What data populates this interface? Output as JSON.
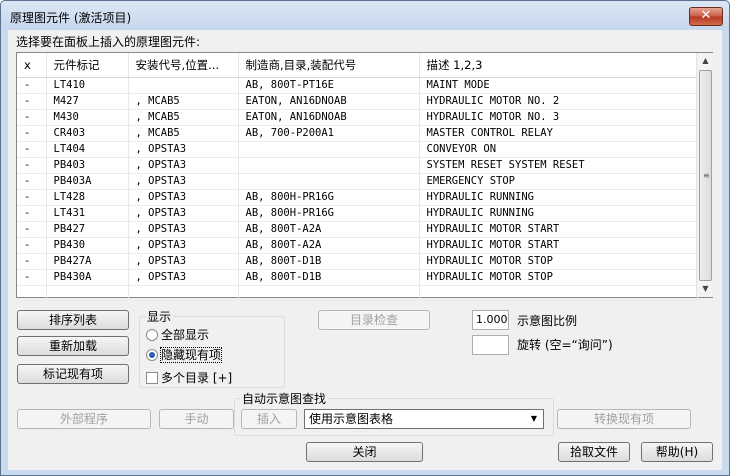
{
  "window": {
    "title": "原理图元件 (激活项目)",
    "close_glyph": "✕"
  },
  "instruction": "选择要在面板上插入的原理图元件:",
  "table": {
    "columns": [
      "x",
      "元件标记",
      "安装代号,位置...",
      "制造商,目录,装配代号",
      "描述 1,2,3"
    ],
    "rows": [
      [
        "-",
        "LT410",
        "",
        "AB, 800T-PT16E",
        "MAINT MODE"
      ],
      [
        "-",
        "M427",
        ", MCAB5",
        "EATON, AN16DNOAB",
        "HYDRAULIC MOTOR NO. 2"
      ],
      [
        "-",
        "M430",
        ", MCAB5",
        "EATON, AN16DNOAB",
        "HYDRAULIC MOTOR NO. 3"
      ],
      [
        "-",
        "CR403",
        ", MCAB5",
        "AB, 700-P200A1",
        "MASTER CONTROL RELAY"
      ],
      [
        "-",
        "LT404",
        ", OPSTA3",
        "",
        "CONVEYOR ON"
      ],
      [
        "-",
        "PB403",
        ", OPSTA3",
        "",
        "SYSTEM RESET SYSTEM RESET"
      ],
      [
        "-",
        "PB403A",
        ", OPSTA3",
        "",
        "EMERGENCY STOP"
      ],
      [
        "-",
        "LT428",
        ", OPSTA3",
        "AB, 800H-PR16G",
        "HYDRAULIC RUNNING"
      ],
      [
        "-",
        "LT431",
        ", OPSTA3",
        "AB, 800H-PR16G",
        "HYDRAULIC RUNNING"
      ],
      [
        "-",
        "PB427",
        ", OPSTA3",
        "AB, 800T-A2A",
        "HYDRAULIC MOTOR START"
      ],
      [
        "-",
        "PB430",
        ", OPSTA3",
        "AB, 800T-A2A",
        "HYDRAULIC MOTOR START"
      ],
      [
        "-",
        "PB427A",
        ", OPSTA3",
        "AB, 800T-D1B",
        "HYDRAULIC MOTOR STOP"
      ],
      [
        "-",
        "PB430A",
        ", OPSTA3",
        "AB, 800T-D1B",
        "HYDRAULIC MOTOR STOP"
      ],
      [
        "",
        "",
        "",
        "",
        ""
      ]
    ]
  },
  "buttons": {
    "sort": "排序列表",
    "reload": "重新加载",
    "mark_existing": "标记现有项",
    "catalog_check": "目录检查",
    "external": "外部程序",
    "manual": "手动",
    "insert": "插入",
    "swap_existing": "转换现有项",
    "close": "关闭",
    "pick_file": "拾取文件",
    "help": "帮助(H)"
  },
  "display_group": {
    "title": "显示",
    "show_all": "全部显示",
    "hide_existing": "隐藏现有项",
    "multi_catalog": "多个目录 [+]",
    "selected": "hide_existing"
  },
  "scale": {
    "value": "1.000",
    "label": "示意图比例"
  },
  "rotation": {
    "value": "",
    "label": "旋转 (空=“询问”)"
  },
  "auto_lookup": {
    "title": "自动示意图查找",
    "selected": "使用示意图表格"
  }
}
